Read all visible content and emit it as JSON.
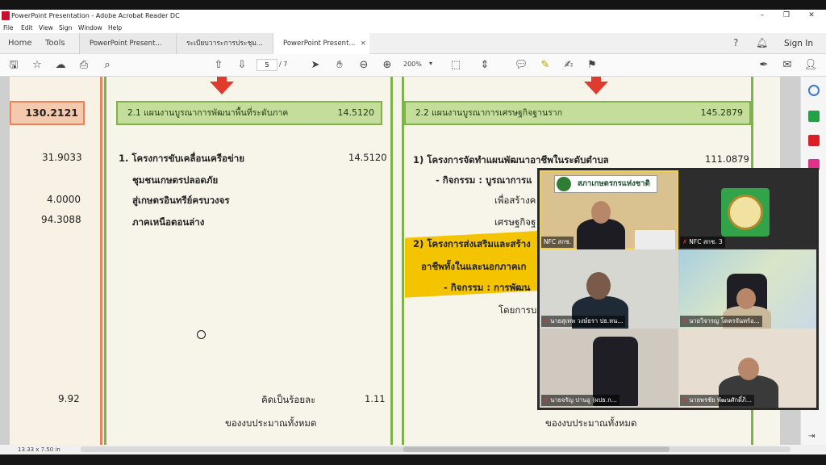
{
  "window": {
    "title": "PowerPoint Presentation - Adobe Acrobat Reader DC",
    "controls": {
      "minimize": "–",
      "maximize": "❐",
      "close": "✕"
    }
  },
  "menu": [
    "File",
    "Edit",
    "View",
    "Sign",
    "Window",
    "Help"
  ],
  "tabs": {
    "home": "Home",
    "tools": "Tools",
    "docs": [
      {
        "label": "PowerPoint Present..."
      },
      {
        "label": "ระเบียบวาระการประชุม..."
      },
      {
        "label": "PowerPoint Present..."
      }
    ],
    "close_glyph": "×",
    "sign_in": "Sign In"
  },
  "toolbar": {
    "page_current": "5",
    "page_total": "/ 7",
    "zoom": "200%",
    "zoom_caret": "▾"
  },
  "document": {
    "left_column": {
      "header_value": "130.2121",
      "values": [
        "31.9033",
        "4.0000",
        "94.3088",
        "9.92"
      ]
    },
    "plan_21": {
      "title": "2.1 แผนงานบูรณาการพัฒนาพื้นที่ระดับภาค",
      "value": "14.5120",
      "project_title": "1. โครงการขับเคลื่อนเครือข่าย",
      "project_value": "14.5120",
      "project_lines": [
        "ชุมชนเกษตรปลอดภัย",
        "สู่เกษตรอินทรีย์ครบวงจร",
        "ภาคเหนือตอนล่าง"
      ],
      "percent_label": "คิดเป็นร้อยละ",
      "percent_value": "1.11",
      "budget_label": "ของงบประมาณทั้งหมด"
    },
    "plan_22": {
      "title": "2.2 แผนงานบูรณาการเศรษฐกิจฐานราก",
      "value": "145.2879",
      "item1": "1) โครงการจัดทำแผนพัฒนาอาชีพในระดับตำบล",
      "item1_value": "111.0879",
      "activity1": "- กิจกรรม : บูรณาการแ",
      "activity1_line2": "เพื่อสร้างค",
      "activity1_line3": "เศรษฐกิจฐ",
      "item2": "2) โครงการส่งเสริมและสร้าง",
      "item2_line2": "อาชีพทั้งในและนอกภาคเก",
      "activity2": "- กิจกรรม : การพัฒน",
      "activity2_line2": "โดยการบ",
      "budget_label": "ของงบประมาณทั้งหมด"
    }
  },
  "status": {
    "page_size": "13.33 x 7.50 in"
  },
  "meeting": {
    "participants": [
      {
        "name": "NFC สกช.",
        "banner": "สภาเกษตรกรแห่งชาติ",
        "active": true,
        "muted": false
      },
      {
        "name": "NFC สกช. 3",
        "muted": true
      },
      {
        "name": "นายสุเทพ วงษ์ธรา ปธ.หน...",
        "muted": true
      },
      {
        "name": "นายวิจารญ โคตรจันทร์อ...",
        "muted": true
      },
      {
        "name": "นายจรัญ ปานอู (ผปธ.ก...",
        "muted": true
      },
      {
        "name": "นายพรชัย พัฒนศักดิ์ภิ...",
        "muted": true
      }
    ],
    "mic_glyph": "✗"
  },
  "colors": {
    "orange": "#e8835a",
    "green": "#7fb24a",
    "highlight": "#f5c400",
    "red_arrow": "#e03b2c"
  }
}
